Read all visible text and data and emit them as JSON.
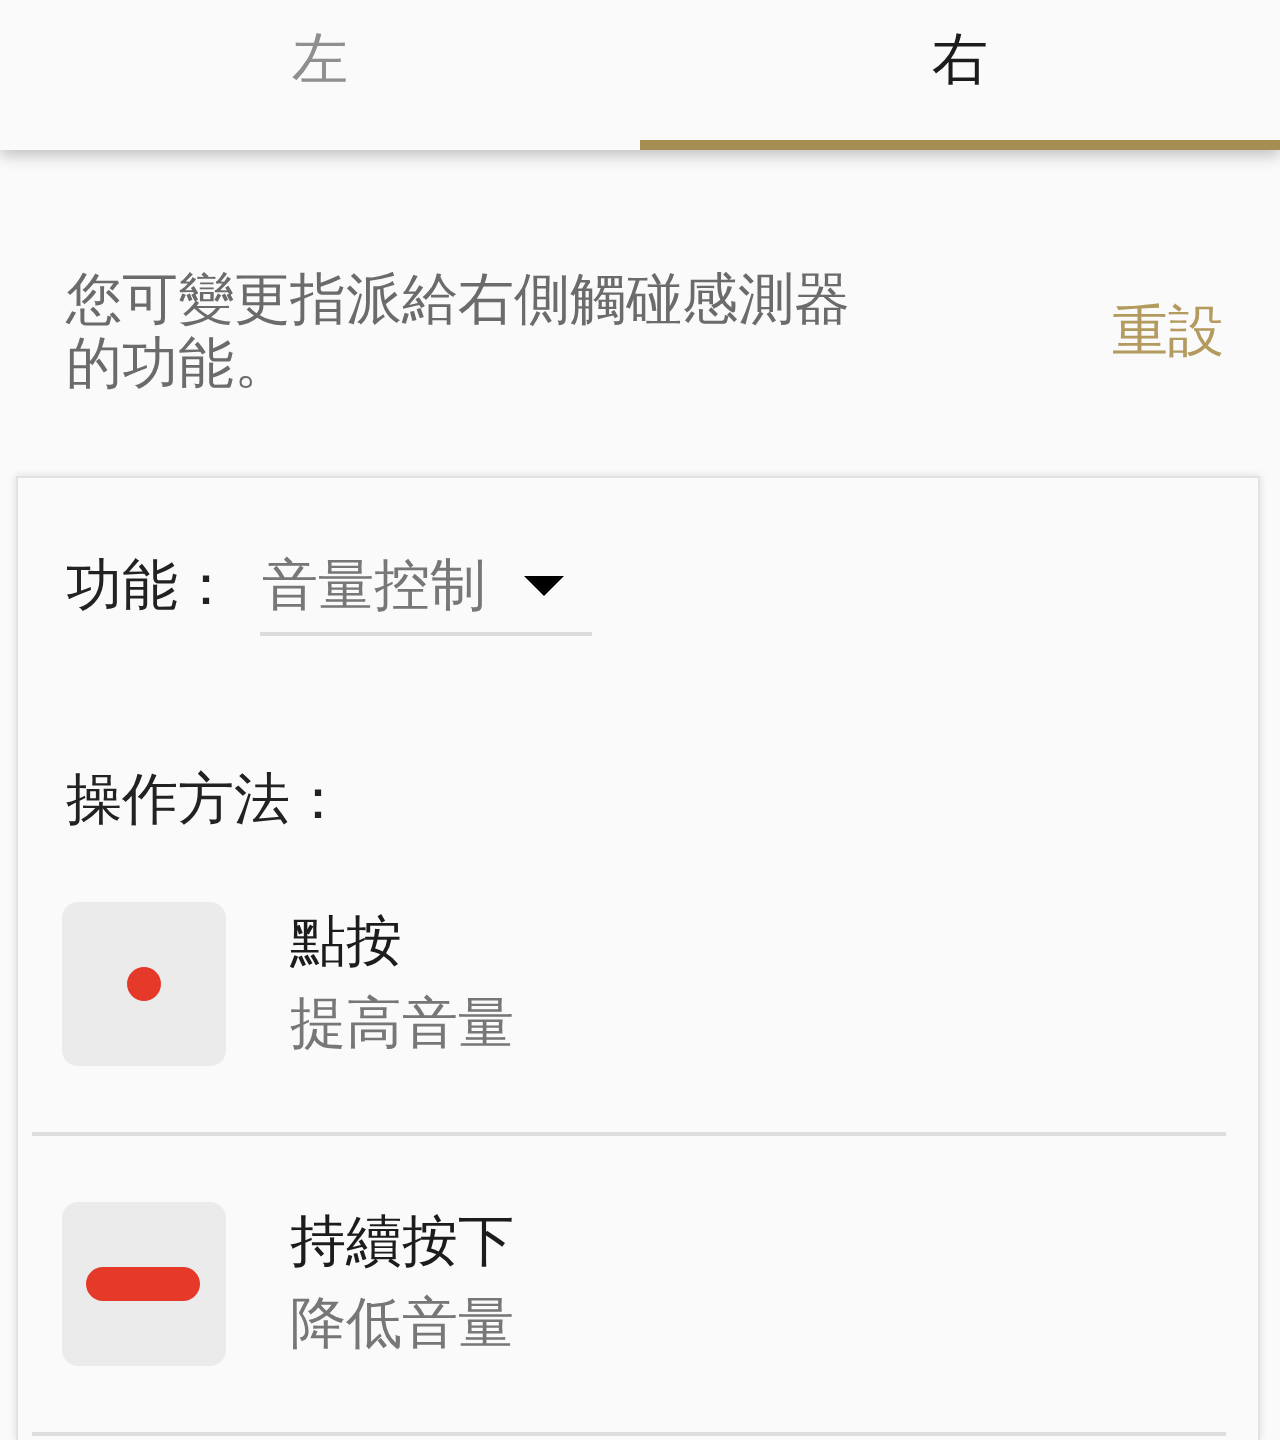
{
  "tabs": [
    {
      "label": "左",
      "selected": false
    },
    {
      "label": "右",
      "selected": true
    }
  ],
  "description": "您可變更指派給右側觸碰感測器的功能。",
  "reset_button": "重設",
  "function_setting": {
    "label": "功能：",
    "value": "音量控制"
  },
  "operation_heading": "操作方法：",
  "operations": [
    {
      "kind": "tap",
      "title": "點按",
      "action": "提高音量"
    },
    {
      "kind": "hold",
      "title": "持續按下",
      "action": "降低音量"
    }
  ]
}
